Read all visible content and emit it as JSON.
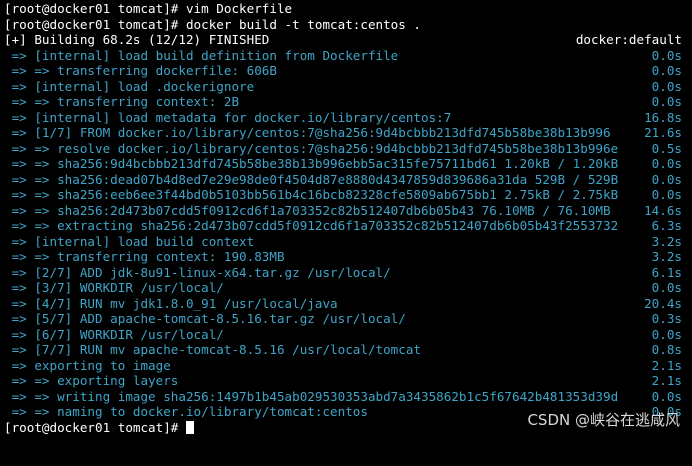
{
  "colors": {
    "background": "#000000",
    "text": "#ffffff",
    "step_text": "#3fa4c8"
  },
  "prompt_lines": [
    "[root@docker01 tomcat]# vim Dockerfile",
    "[root@docker01 tomcat]# docker build -t tomcat:centos ."
  ],
  "status": {
    "left": "[+] Building 68.2s (12/12) FINISHED",
    "right": "docker:default"
  },
  "steps": [
    {
      "text": " => [internal] load build definition from Dockerfile",
      "time": "0.0s"
    },
    {
      "text": " => => transferring dockerfile: 606B",
      "time": "0.0s"
    },
    {
      "text": " => [internal] load .dockerignore",
      "time": "0.0s"
    },
    {
      "text": " => => transferring context: 2B",
      "time": "0.0s"
    },
    {
      "text": " => [internal] load metadata for docker.io/library/centos:7",
      "time": "16.8s"
    },
    {
      "text": " => [1/7] FROM docker.io/library/centos:7@sha256:9d4bcbbb213dfd745b58be38b13b996",
      "time": "21.6s"
    },
    {
      "text": " => => resolve docker.io/library/centos:7@sha256:9d4bcbbb213dfd745b58be38b13b996e",
      "time": "0.5s"
    },
    {
      "text": " => => sha256:9d4bcbbb213dfd745b58be38b13b996ebb5ac315fe75711bd61 1.20kB / 1.20kB",
      "time": "0.0s"
    },
    {
      "text": " => => sha256:dead07b4d8ed7e29e98de0f4504d87e8880d4347859d839686a31da 529B / 529B",
      "time": "0.0s"
    },
    {
      "text": " => => sha256:eeb6ee3f44bd0b5103bb561b4c16bcb82328cfe5809ab675bb1 2.75kB / 2.75kB",
      "time": "0.0s"
    },
    {
      "text": " => => sha256:2d473b07cdd5f0912cd6f1a703352c82b512407db6b05b43 76.10MB / 76.10MB",
      "time": "14.6s"
    },
    {
      "text": " => => extracting sha256:2d473b07cdd5f0912cd6f1a703352c82b512407db6b05b43f2553732",
      "time": "6.3s"
    },
    {
      "text": " => [internal] load build context",
      "time": "3.2s"
    },
    {
      "text": " => => transferring context: 190.83MB",
      "time": "3.2s"
    },
    {
      "text": " => [2/7] ADD jdk-8u91-linux-x64.tar.gz /usr/local/",
      "time": "6.1s"
    },
    {
      "text": " => [3/7] WORKDIR /usr/local/",
      "time": "0.0s"
    },
    {
      "text": " => [4/7] RUN mv jdk1.8.0_91 /usr/local/java",
      "time": "20.4s"
    },
    {
      "text": " => [5/7] ADD apache-tomcat-8.5.16.tar.gz /usr/local/",
      "time": "0.3s"
    },
    {
      "text": " => [6/7] WORKDIR /usr/local/",
      "time": "0.0s"
    },
    {
      "text": " => [7/7] RUN mv apache-tomcat-8.5.16 /usr/local/tomcat",
      "time": "0.8s"
    },
    {
      "text": " => exporting to image",
      "time": "2.1s"
    },
    {
      "text": " => => exporting layers",
      "time": "2.1s"
    },
    {
      "text": " => => writing image sha256:1497b1b45ab029530353abd7a3435862b1c5f67642b481353d39d",
      "time": "0.0s"
    },
    {
      "text": " => => naming to docker.io/library/tomcat:centos",
      "time": "0.0s"
    }
  ],
  "final_prompt": "[root@docker01 tomcat]# ",
  "watermark": "CSDN @峡谷在逃咸风"
}
